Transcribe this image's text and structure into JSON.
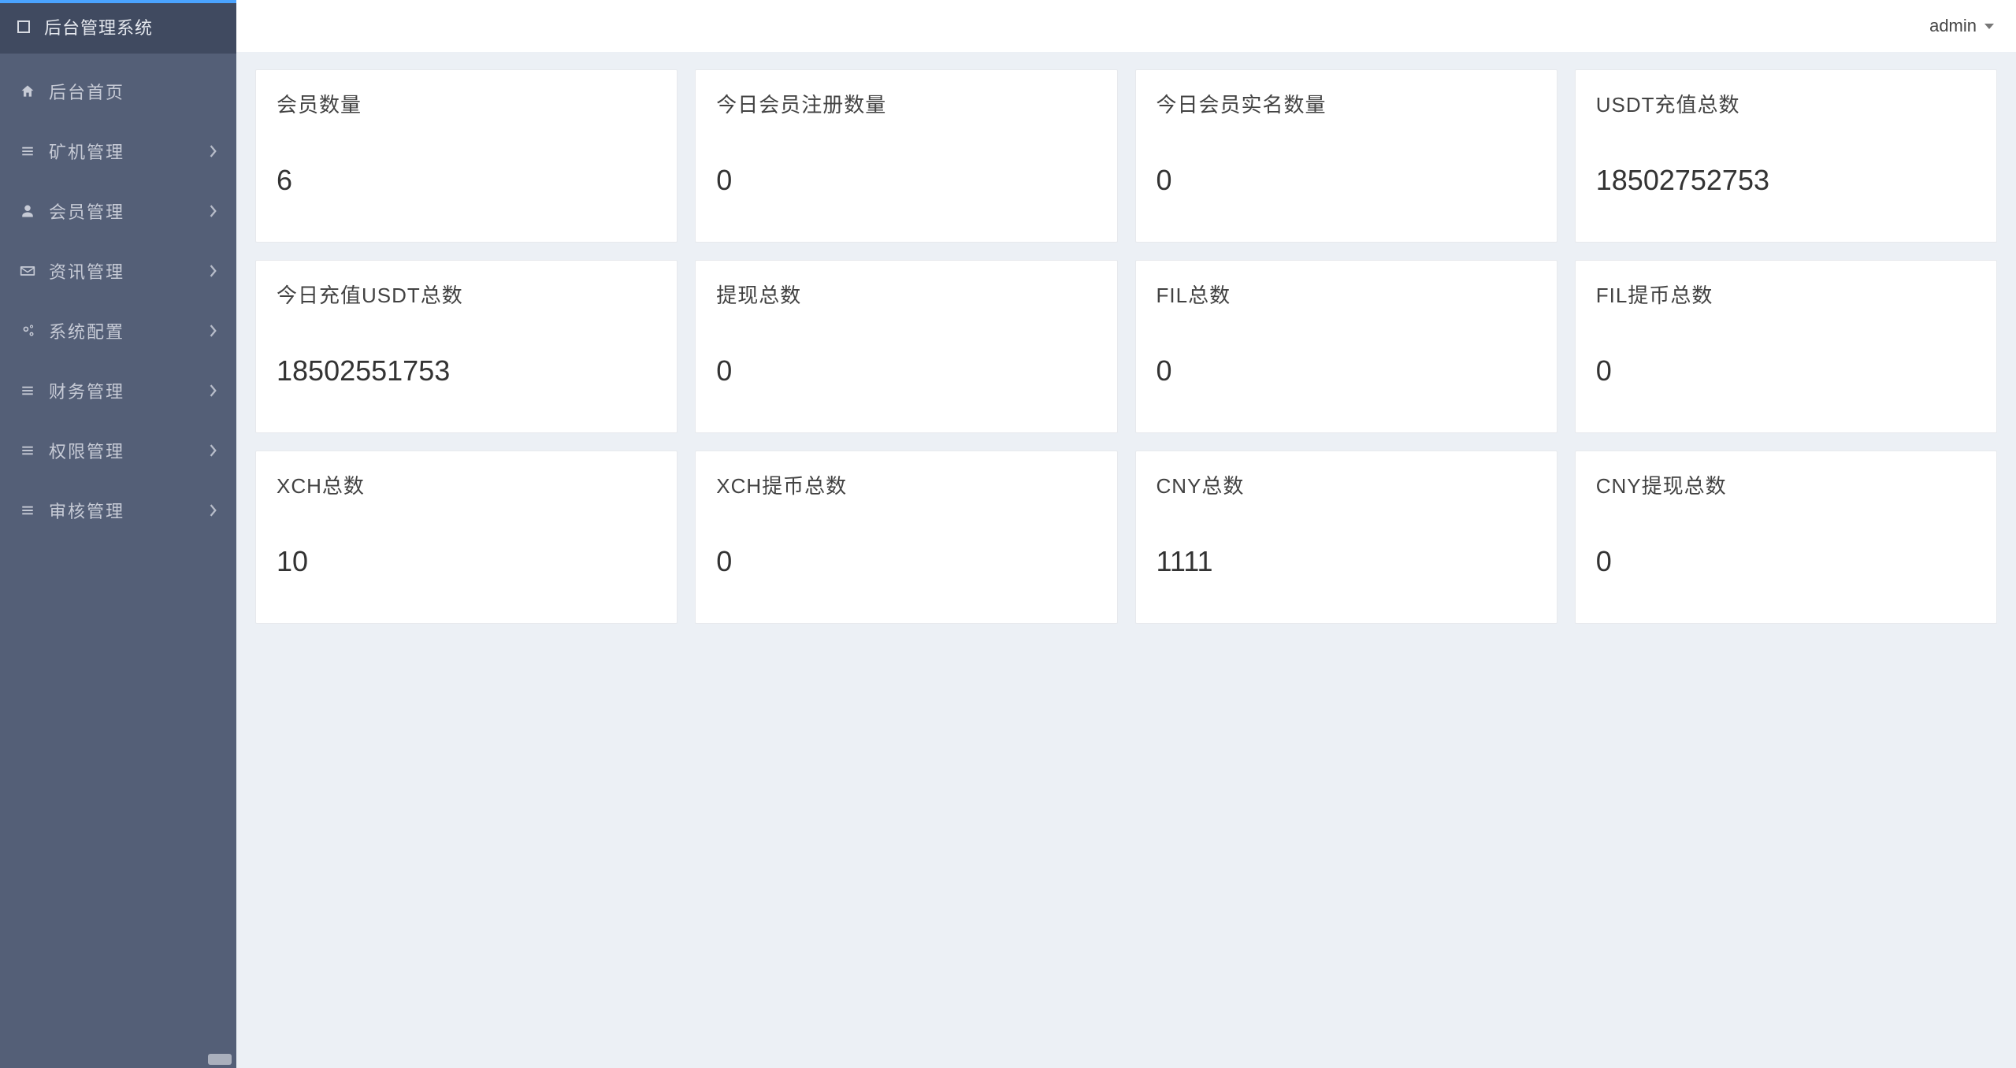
{
  "app": {
    "title": "后台管理系统"
  },
  "sidebar": {
    "items": [
      {
        "icon": "home-icon",
        "label": "后台首页",
        "expandable": false
      },
      {
        "icon": "bars-icon",
        "label": "矿机管理",
        "expandable": true
      },
      {
        "icon": "user-icon",
        "label": "会员管理",
        "expandable": true
      },
      {
        "icon": "envelope-icon",
        "label": "资讯管理",
        "expandable": true
      },
      {
        "icon": "cogs-icon",
        "label": "系统配置",
        "expandable": true
      },
      {
        "icon": "bars-icon",
        "label": "财务管理",
        "expandable": true
      },
      {
        "icon": "bars-icon",
        "label": "权限管理",
        "expandable": true
      },
      {
        "icon": "bars-icon",
        "label": "审核管理",
        "expandable": true
      }
    ]
  },
  "topbar": {
    "user_label": "admin"
  },
  "dashboard": {
    "cards": [
      {
        "title": "会员数量",
        "value": "6"
      },
      {
        "title": "今日会员注册数量",
        "value": "0"
      },
      {
        "title": "今日会员实名数量",
        "value": "0"
      },
      {
        "title": "USDT充值总数",
        "value": "18502752753"
      },
      {
        "title": "今日充值USDT总数",
        "value": "18502551753"
      },
      {
        "title": "提现总数",
        "value": "0"
      },
      {
        "title": "FIL总数",
        "value": "0"
      },
      {
        "title": "FIL提币总数",
        "value": "0"
      },
      {
        "title": "XCH总数",
        "value": "10"
      },
      {
        "title": "XCH提币总数",
        "value": "0"
      },
      {
        "title": "CNY总数",
        "value": "1111"
      },
      {
        "title": "CNY提现总数",
        "value": "0"
      }
    ]
  },
  "colors": {
    "sidebar_bg": "#545f77",
    "sidebar_header_bg": "#404a60",
    "accent": "#4aa3ff",
    "page_bg": "#ecf0f5",
    "card_bg": "#ffffff"
  }
}
